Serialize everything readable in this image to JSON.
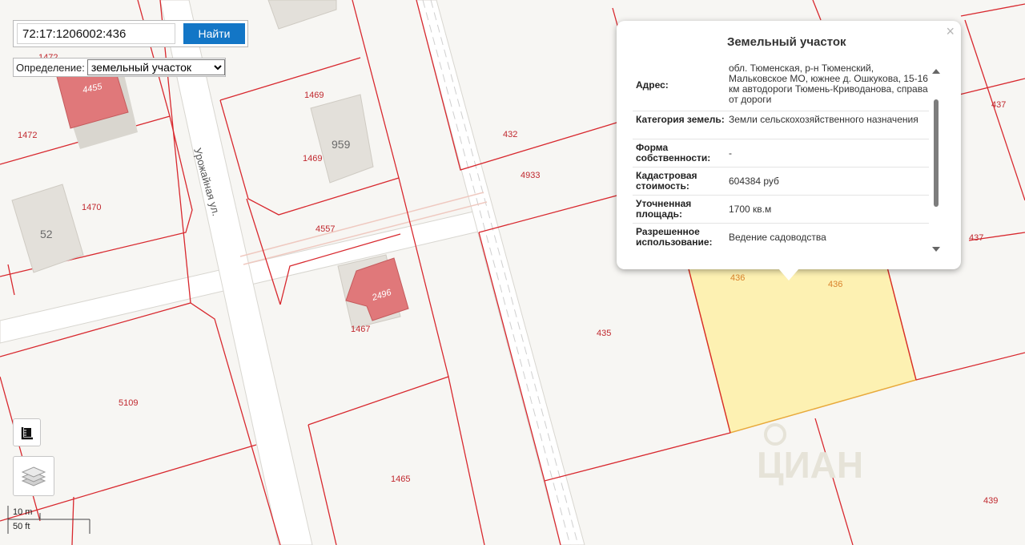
{
  "search": {
    "value": "72:17:1206002:436",
    "button_label": "Найти"
  },
  "definition": {
    "label": "Определение:",
    "selected": "земельный участок",
    "options": [
      "земельный участок"
    ]
  },
  "popup": {
    "title": "Земельный участок",
    "close": "×",
    "rows": [
      {
        "key": "Адрес:",
        "value": "обл. Тюменская, р-н Тюменский, Мальковское МО, южнее д. Ошкукова, 15-16 км автодороги Тюмень-Криводанова, справа от дороги"
      },
      {
        "key": "Категория земель:",
        "value": "Земли сельскохозяйственного назначения"
      },
      {
        "key": "Форма собственности:",
        "value": "-"
      },
      {
        "key": "Кадастровая стоимость:",
        "value": "604384 руб"
      },
      {
        "key": "Уточненная площадь:",
        "value": "1700 кв.м"
      },
      {
        "key": "Разрешенное использование:",
        "value": "Ведение садоводства"
      }
    ]
  },
  "map": {
    "street_name": "Урожайная ул.",
    "parcel_labels": [
      "1472",
      "1472",
      "1469",
      "1469",
      "432",
      "4933",
      "437",
      "437",
      "1470",
      "4557",
      "1467",
      "435",
      "436",
      "436",
      "5109",
      "1465",
      "439"
    ],
    "building_labels": [
      "4455",
      "959",
      "52",
      "2496"
    ],
    "watermark": "ЦИАН"
  },
  "scale": {
    "metric": "10 m",
    "imperial": "50 ft"
  },
  "colors": {
    "parcel_border": "#d8282e",
    "selected_fill": "#fdf1b2",
    "selected_border": "#e8a93a",
    "building": "#e0ddd7",
    "building_highlight": "#e0787a",
    "button": "#1376c6"
  },
  "icons": {
    "ruler": "ruler-icon",
    "layers": "layers-icon"
  }
}
